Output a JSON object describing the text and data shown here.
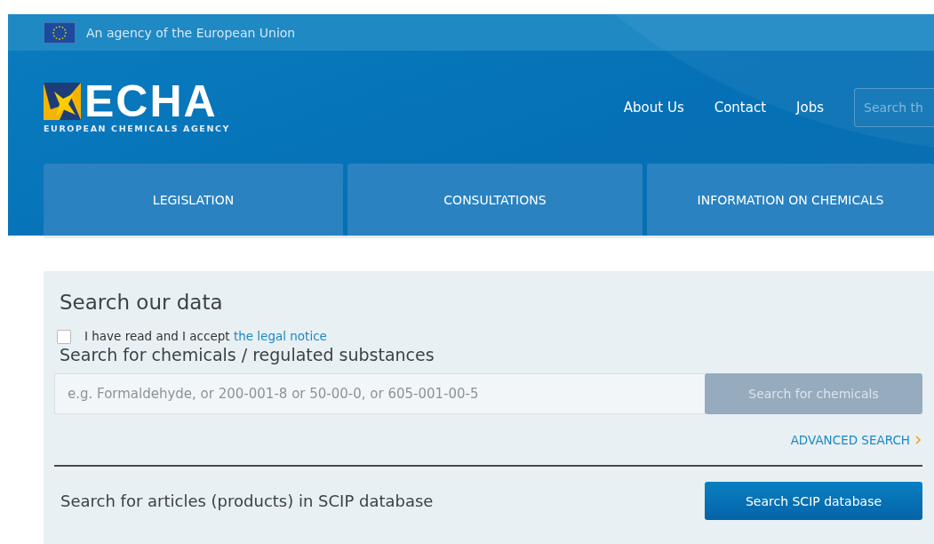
{
  "top_bar": {
    "text": "An agency of the European Union"
  },
  "logo": {
    "wordmark": "ECHA",
    "subtitle": "EUROPEAN CHEMICALS AGENCY"
  },
  "header_links": [
    "About Us",
    "Contact",
    "Jobs"
  ],
  "header_search": {
    "placeholder": "Search th"
  },
  "nav_tabs": [
    {
      "label": "LEGISLATION",
      "selected": false
    },
    {
      "label": "CONSULTATIONS",
      "selected": false
    },
    {
      "label": "INFORMATION ON CHEMICALS",
      "selected": false
    }
  ],
  "search_panel": {
    "title": "Search our data",
    "legal": {
      "text": "I have read and I accept ",
      "link": "the legal notice",
      "checked": false
    },
    "chemicals_heading": "Search for chemicals / regulated substances",
    "chemicals_field": {
      "placeholder": "e.g. Formaldehyde, or 200-001-8 or 50-00-0, or 605-001-00-5"
    },
    "chemicals_button": {
      "label": "Search for chemicals",
      "disabled": true
    },
    "advanced_link": "ADVANCED SEARCH",
    "scip_heading": "Search for articles (products) in SCIP database",
    "scip_button": {
      "label": "Search SCIP database",
      "disabled": false
    }
  }
}
